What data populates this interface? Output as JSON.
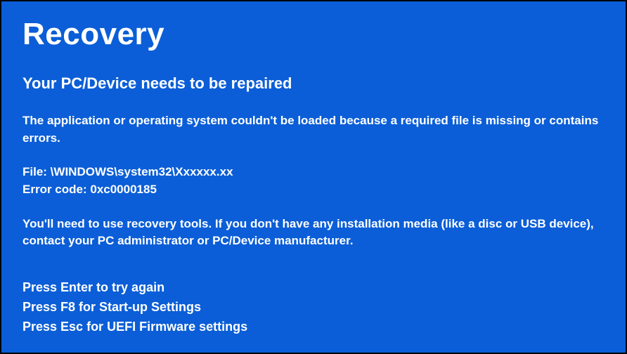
{
  "title": "Recovery",
  "subtitle": "Your PC/Device needs to be repaired",
  "message": "The application or operating system couldn't be loaded because a required file is missing or contains errors.",
  "file_label": "File: ",
  "file_path": "\\WINDOWS\\system32\\Xxxxxx.xx",
  "error_label": "Error code: ",
  "error_code": "0xc0000185",
  "instruction": "You'll need to use recovery tools. If you don't have any installation media (like a disc or USB device), contact your PC administrator or PC/Device manufacturer.",
  "actions": {
    "enter": "Press Enter to try again",
    "f8": "Press F8 for Start-up Settings",
    "esc": "Press Esc for UEFI Firmware settings"
  }
}
